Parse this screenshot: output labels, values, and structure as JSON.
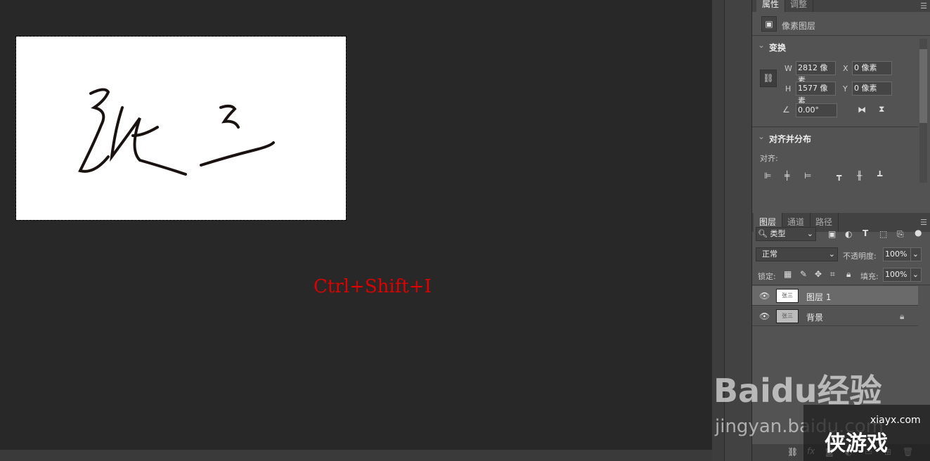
{
  "canvas": {
    "signature_text": "张三",
    "shortcut_hint": "Ctrl+Shift+I",
    "hint_color": "#e00000"
  },
  "properties": {
    "tabs": [
      {
        "label": "属性"
      },
      {
        "label": "调整"
      }
    ],
    "layer_kind": "像素图层",
    "transform": {
      "title": "变换",
      "w_label": "W",
      "w": "2812 像素",
      "h_label": "H",
      "h": "1577 像素",
      "x_label": "X",
      "x": "0 像素",
      "y_label": "Y",
      "y": "0 像素",
      "angle": "0.00°"
    },
    "align": {
      "title": "对齐并分布",
      "label": "对齐:"
    }
  },
  "layers": {
    "tabs": [
      {
        "label": "图层"
      },
      {
        "label": "通道"
      },
      {
        "label": "路径"
      }
    ],
    "filter": "类型",
    "blend_mode": "正常",
    "opacity_label": "不透明度:",
    "opacity": "100%",
    "lock_label": "锁定:",
    "fill_label": "填充:",
    "fill": "100%",
    "items": [
      {
        "name": "图层 1",
        "selected": true,
        "visible": true
      },
      {
        "name": "背景",
        "locked": true,
        "visible": true
      }
    ]
  },
  "watermark": {
    "brand": "Baidu经验",
    "url": "jingyan.baidu.com",
    "site": "xiayx.com",
    "site_name": "侠游戏"
  }
}
